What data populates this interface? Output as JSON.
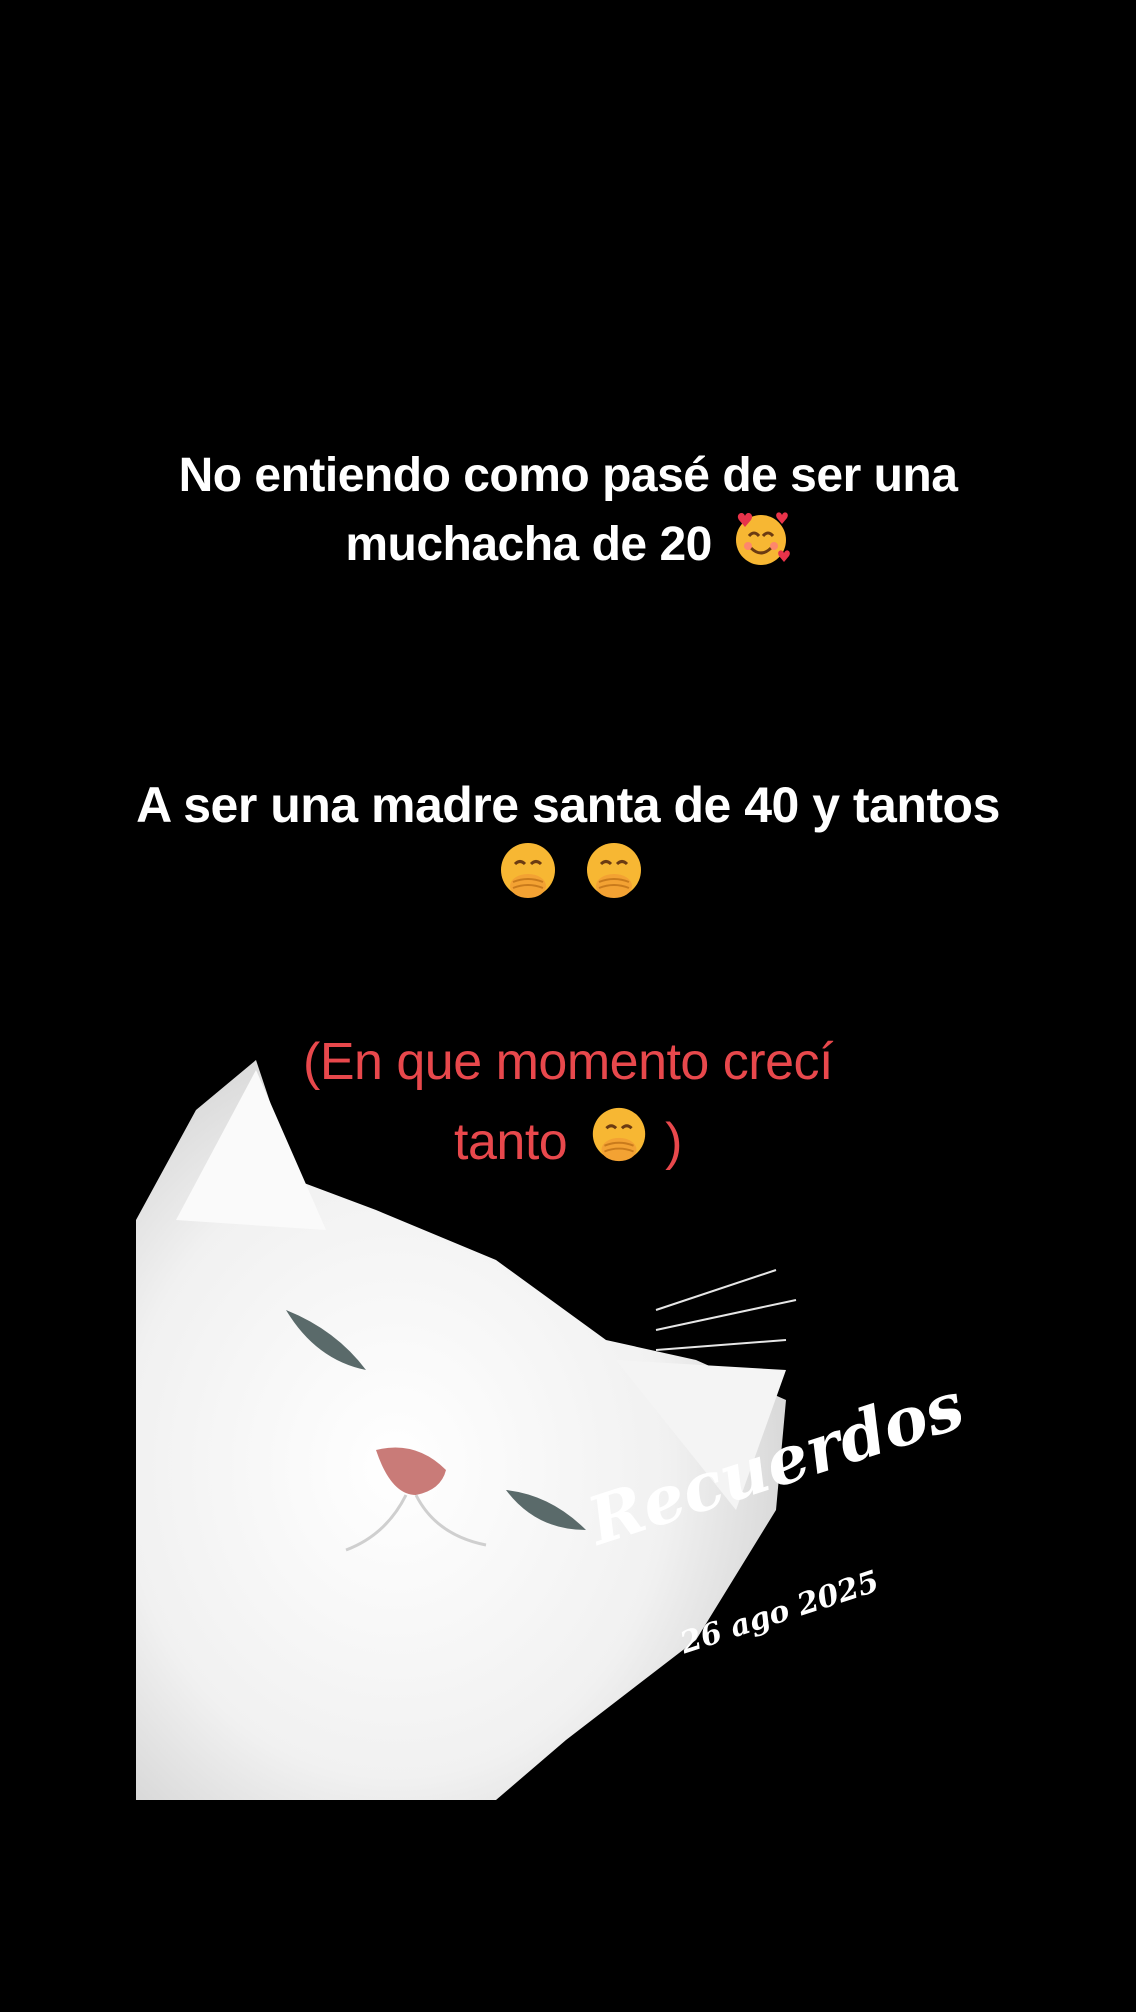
{
  "caption": {
    "line1_a": "No entiendo como pasé de ser una",
    "line1_b": "muchacha de 20",
    "line2_a": "A ser una madre santa de 40 y tantos",
    "line3_a": "(En que momento crecí",
    "line3_b": "tanto",
    "line3_c": ")"
  },
  "overlay": {
    "title": "Recuerdos",
    "date": "26 ago 2025"
  },
  "colors": {
    "background": "#000000",
    "caption": "#ffffff",
    "highlight": "#e8484c"
  },
  "icons": {
    "smiling_hearts": "smiling-face-with-hearts-icon",
    "hand_over_mouth": "face-with-hand-over-mouth-icon"
  }
}
